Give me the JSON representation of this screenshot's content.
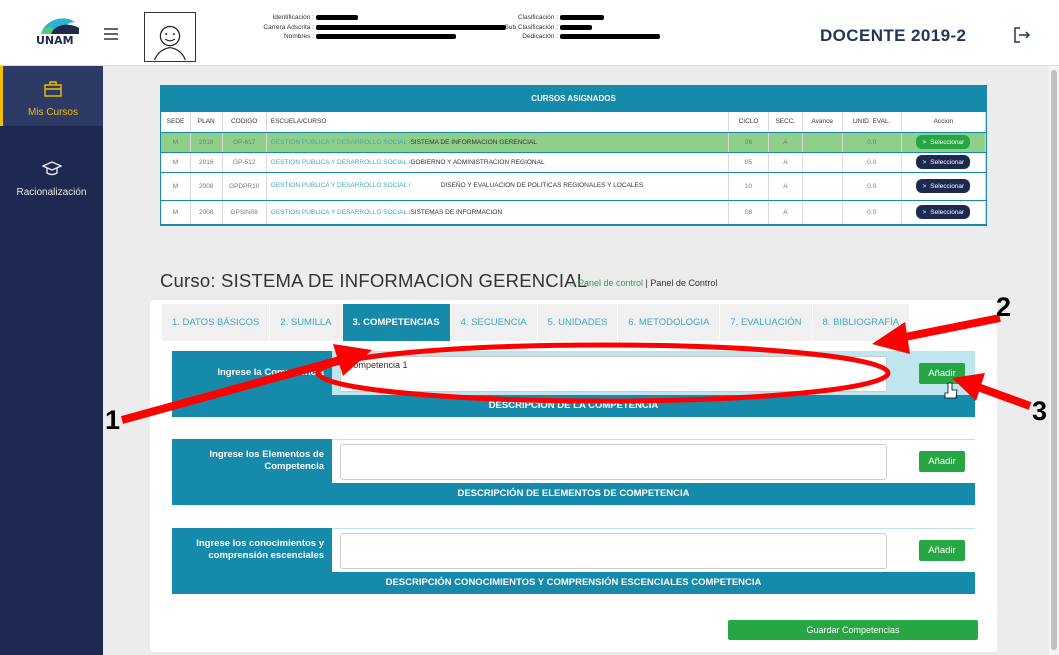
{
  "header": {
    "logo_text": "UNAM",
    "title": "DOCENTE 2019-2",
    "info_left": [
      {
        "label": "Identificación :"
      },
      {
        "label": "Carrera Adscrita :"
      },
      {
        "label": "Nombres :"
      }
    ],
    "info_right": [
      {
        "label": "Clasificación :"
      },
      {
        "label": "Sub Clasificación :"
      },
      {
        "label": "Dedicación :"
      }
    ]
  },
  "sidebar": {
    "items": [
      {
        "label": "Mis Cursos",
        "icon": "briefcase-icon",
        "active": true
      },
      {
        "label": "Racionalización",
        "icon": "graduation-cap-icon",
        "active": false
      }
    ]
  },
  "courses": {
    "title": "CURSOS ASIGNADOS",
    "columns": [
      "SEDE",
      "PLAN",
      "CODIGO",
      "ESCUELA/CURSO",
      "CICLO",
      "SECC.",
      "Avance",
      "UNID. EVAL.",
      "Accion"
    ],
    "rows": [
      {
        "sede": "M",
        "plan": "2016",
        "codigo": "GP-617",
        "escuela": "GESTION PUBLICA Y DESARROLLO SOCIAL /",
        "curso": "SISTEMA DE INFORMACION GERENCIAL",
        "ciclo": "06",
        "secc": "A",
        "avance": "",
        "unid": "0.0",
        "accion": "Seleccionar",
        "selected": true
      },
      {
        "sede": "M",
        "plan": "2016",
        "codigo": "GP-512",
        "escuela": "GESTION PUBLICA Y DESARROLLO SOCIAL /",
        "curso": "GOBIERNO Y ADMINISTRACION REGIONAL",
        "ciclo": "05",
        "secc": "A",
        "avance": "",
        "unid": "0.0",
        "accion": "Seleccionar",
        "selected": false
      },
      {
        "sede": "M",
        "plan": "2008",
        "codigo": "GPDPR10",
        "escuela": "GESTION PUBLICA Y DESARROLLO SOCIAL /",
        "curso": "DISEÑO Y EVALUACION DE POLITICAS REGIONALES Y LOCALES",
        "ciclo": "10",
        "secc": "A",
        "avance": "",
        "unid": "0.0",
        "accion": "Seleccionar",
        "selected": false
      },
      {
        "sede": "M",
        "plan": "2008",
        "codigo": "GPSIN08",
        "escuela": "GESTION PUBLICA Y DESARROLLO SOCIAL /",
        "curso": "SISTEMAS DE INFORMACION",
        "ciclo": "08",
        "secc": "A",
        "avance": "",
        "unid": "0.0",
        "accion": "Seleccionar",
        "selected": false
      }
    ]
  },
  "course_heading": {
    "prefix": "Curso:",
    "name": "SISTEMA DE INFORMACION GERENCIAL",
    "home_link": "Panel de control",
    "separator": "|",
    "breadcrumb": "Panel de Control"
  },
  "tabs": [
    {
      "label": "1. DATOS BÁSICOS",
      "active": false
    },
    {
      "label": "2. SUMILLA",
      "active": false
    },
    {
      "label": "3. COMPETENCIAS",
      "active": true
    },
    {
      "label": "4. SECUENCIA",
      "active": false
    },
    {
      "label": "5. UNIDADES",
      "active": false
    },
    {
      "label": "6. METODOLOGIA",
      "active": false
    },
    {
      "label": "7. EVALUACIÓN",
      "active": false
    },
    {
      "label": "8. BIBLIOGRAFÍA",
      "active": false
    }
  ],
  "sections": [
    {
      "label": "Ingrese la Competencia",
      "value": "Competencia 1",
      "button": "Añadir",
      "footer": "DESCRIPCIÓN DE LA COMPETENCIA"
    },
    {
      "label": "Ingrese los Elementos de Competencia",
      "value": "",
      "button": "Añadir",
      "footer": "DESCRIPCIÓN DE ELEMENTOS DE COMPETENCIA"
    },
    {
      "label": "Ingrese los conocimientos y comprensión escenciales",
      "value": "",
      "button": "Añadir",
      "footer": "DESCRIPCIÓN CONOCIMIENTOS Y COMPRENSIÓN ESCENCIALES COMPETENCIA"
    }
  ],
  "save_button": "Guardar Competencias",
  "annotations": [
    "1",
    "2",
    "3"
  ],
  "colors": {
    "sidebar_bg": "#1d2951",
    "accent_teal": "#168aab",
    "green": "#27a743",
    "annotation_red": "#ff0000",
    "active_yellow": "#f0c000"
  }
}
